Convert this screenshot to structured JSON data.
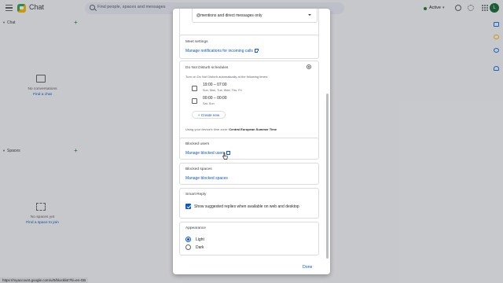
{
  "app": {
    "title": "Chat",
    "search_placeholder": "Find people, spaces and messages",
    "status": "Active",
    "avatar_initial": "L"
  },
  "sidebar": {
    "chat_section": "Chat",
    "chat_empty": "No conversations",
    "chat_link": "Find a chat",
    "spaces_section": "Spaces",
    "spaces_empty": "No spaces yet",
    "spaces_link": "Find a space to join"
  },
  "status_url": "https://myaccount.google.com/u/0/blocklist?hl=en-GB",
  "dialog": {
    "notifications_select": "@mentions and direct messages only",
    "meet": {
      "title": "Meet settings",
      "link": "Manage notifications for incoming calls"
    },
    "dnd": {
      "title": "Do Not Disturb schedules",
      "subtitle": "Turn on Do Not Disturb automatically at the following times:",
      "schedules": [
        {
          "time": "19:00 – 07:00",
          "days": "Sun, Mon, Tue, Wed, Thu, Fri",
          "checked": false
        },
        {
          "time": "00:00 – 00:00",
          "days": "Sat, Sun",
          "checked": false
        }
      ],
      "create_new": "+ Create new",
      "timezone_prefix": "Using your device's time zone: ",
      "timezone": "Central European Summer Time"
    },
    "blocked_users": {
      "title": "Blocked users",
      "link": "Manage blocked users"
    },
    "blocked_spaces": {
      "title": "Blocked spaces",
      "link": "Manage blocked spaces"
    },
    "smart_reply": {
      "title": "Smart Reply",
      "option": "Show suggested replies when available on web and desktop",
      "checked": true
    },
    "appearance": {
      "title": "Appearance",
      "options": [
        {
          "label": "Light",
          "selected": true
        },
        {
          "label": "Dark",
          "selected": false
        }
      ]
    },
    "done_label": "Done"
  },
  "colors": {
    "accent": "#0b57d0",
    "status_active": "#188038"
  },
  "icons": [
    "menu-icon",
    "chat-logo-icon",
    "search-icon",
    "help-icon",
    "settings-icon",
    "apps-grid-icon",
    "external-link-icon",
    "gear-icon",
    "pointer-cursor-icon"
  ]
}
